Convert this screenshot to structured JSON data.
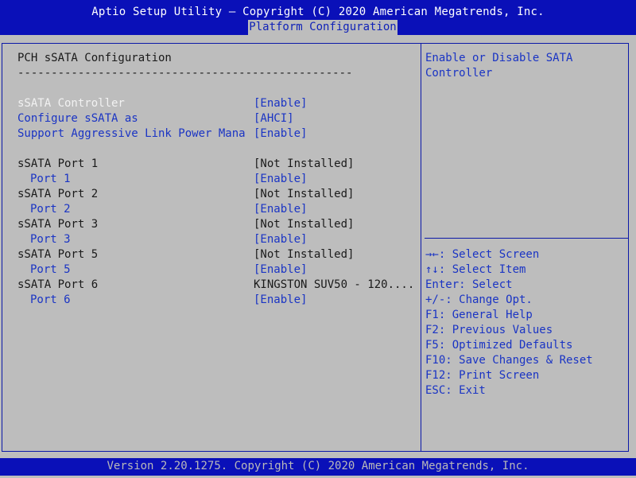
{
  "header": {
    "title": "Aptio Setup Utility – Copyright (C) 2020 American Megatrends, Inc.",
    "tab": "Platform Configuration"
  },
  "main": {
    "section_title": "PCH sSATA Configuration",
    "rule": "--------------------------------------------------",
    "settings": [
      {
        "label": "sSATA Controller",
        "value": "[Enable]"
      },
      {
        "label": "Configure sSATA as",
        "value": "[AHCI]"
      },
      {
        "label": "Support Aggressive Link Power Mana",
        "value": "[Enable]"
      }
    ],
    "ports": [
      {
        "name": "sSATA Port 1",
        "status": "[Not Installed]",
        "sub_label": "Port 1",
        "sub_value": "[Enable]"
      },
      {
        "name": "sSATA Port 2",
        "status": "[Not Installed]",
        "sub_label": "Port 2",
        "sub_value": "[Enable]"
      },
      {
        "name": "sSATA Port 3",
        "status": "[Not Installed]",
        "sub_label": "Port 3",
        "sub_value": "[Enable]"
      },
      {
        "name": "sSATA Port 5",
        "status": "[Not Installed]",
        "sub_label": "Port 5",
        "sub_value": "[Enable]"
      },
      {
        "name": "sSATA Port 6",
        "status": "KINGSTON SUV50 - 120....",
        "sub_label": "Port 6",
        "sub_value": "[Enable]"
      }
    ]
  },
  "help": {
    "text": [
      "Enable or Disable SATA",
      "Controller"
    ],
    "keys": [
      "→←: Select Screen",
      "↑↓: Select Item",
      "Enter: Select",
      "+/-: Change Opt.",
      "F1: General Help",
      "F2: Previous Values",
      "F5: Optimized Defaults",
      "F10: Save Changes & Reset",
      "F12: Print Screen",
      "ESC: Exit"
    ]
  },
  "footer": {
    "version": "Version 2.20.1275. Copyright (C) 2020 American Megatrends, Inc."
  },
  "colors": {
    "header_bg": "#0a10b8",
    "body_bg": "#bdbdbd",
    "selected_text": "#f2f2f2",
    "option_text": "#1a34c4"
  }
}
